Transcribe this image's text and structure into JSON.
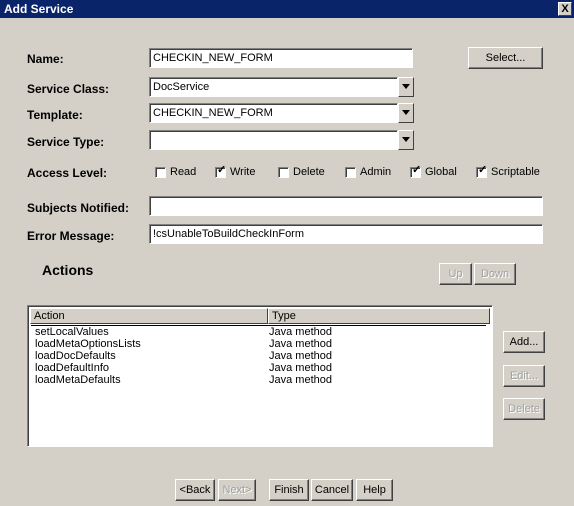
{
  "window": {
    "title": "Add Service",
    "close_glyph": "X"
  },
  "form": {
    "name": {
      "label": "Name:",
      "value": "CHECKIN_NEW_FORM"
    },
    "select_label": "Select...",
    "service_class": {
      "label": "Service Class:",
      "value": "DocService"
    },
    "template": {
      "label": "Template:",
      "value": "CHECKIN_NEW_FORM"
    },
    "service_type": {
      "label": "Service Type:",
      "value": ""
    },
    "access_level": {
      "label": "Access Level:",
      "options": [
        {
          "label": "Read",
          "checked": false
        },
        {
          "label": "Write",
          "checked": true
        },
        {
          "label": "Delete",
          "checked": false
        },
        {
          "label": "Admin",
          "checked": false
        },
        {
          "label": "Global",
          "checked": true
        },
        {
          "label": "Scriptable",
          "checked": true
        }
      ]
    },
    "subjects_notified": {
      "label": "Subjects Notified:",
      "value": ""
    },
    "error_message": {
      "label": "Error Message:",
      "value": "!csUnableToBuildCheckInForm"
    }
  },
  "actions": {
    "title": "Actions",
    "up_label": "Up",
    "down_label": "Down",
    "columns": [
      "Action",
      "Type"
    ],
    "rows": [
      {
        "action": "setLocalValues",
        "type": "Java method"
      },
      {
        "action": "loadMetaOptionsLists",
        "type": "Java method"
      },
      {
        "action": "loadDocDefaults",
        "type": "Java method"
      },
      {
        "action": "loadDefaultInfo",
        "type": "Java method"
      },
      {
        "action": "loadMetaDefaults",
        "type": "Java method"
      }
    ],
    "add_label": "Add...",
    "edit_label": "Edit...",
    "delete_label": "Delete"
  },
  "footer": {
    "back_label": "<Back",
    "next_label": "Next>",
    "finish_label": "Finish",
    "cancel_label": "Cancel",
    "help_label": "Help"
  },
  "colors": {
    "titlebar": "#0a246a",
    "dialog_bg": "#d4d0c8"
  }
}
